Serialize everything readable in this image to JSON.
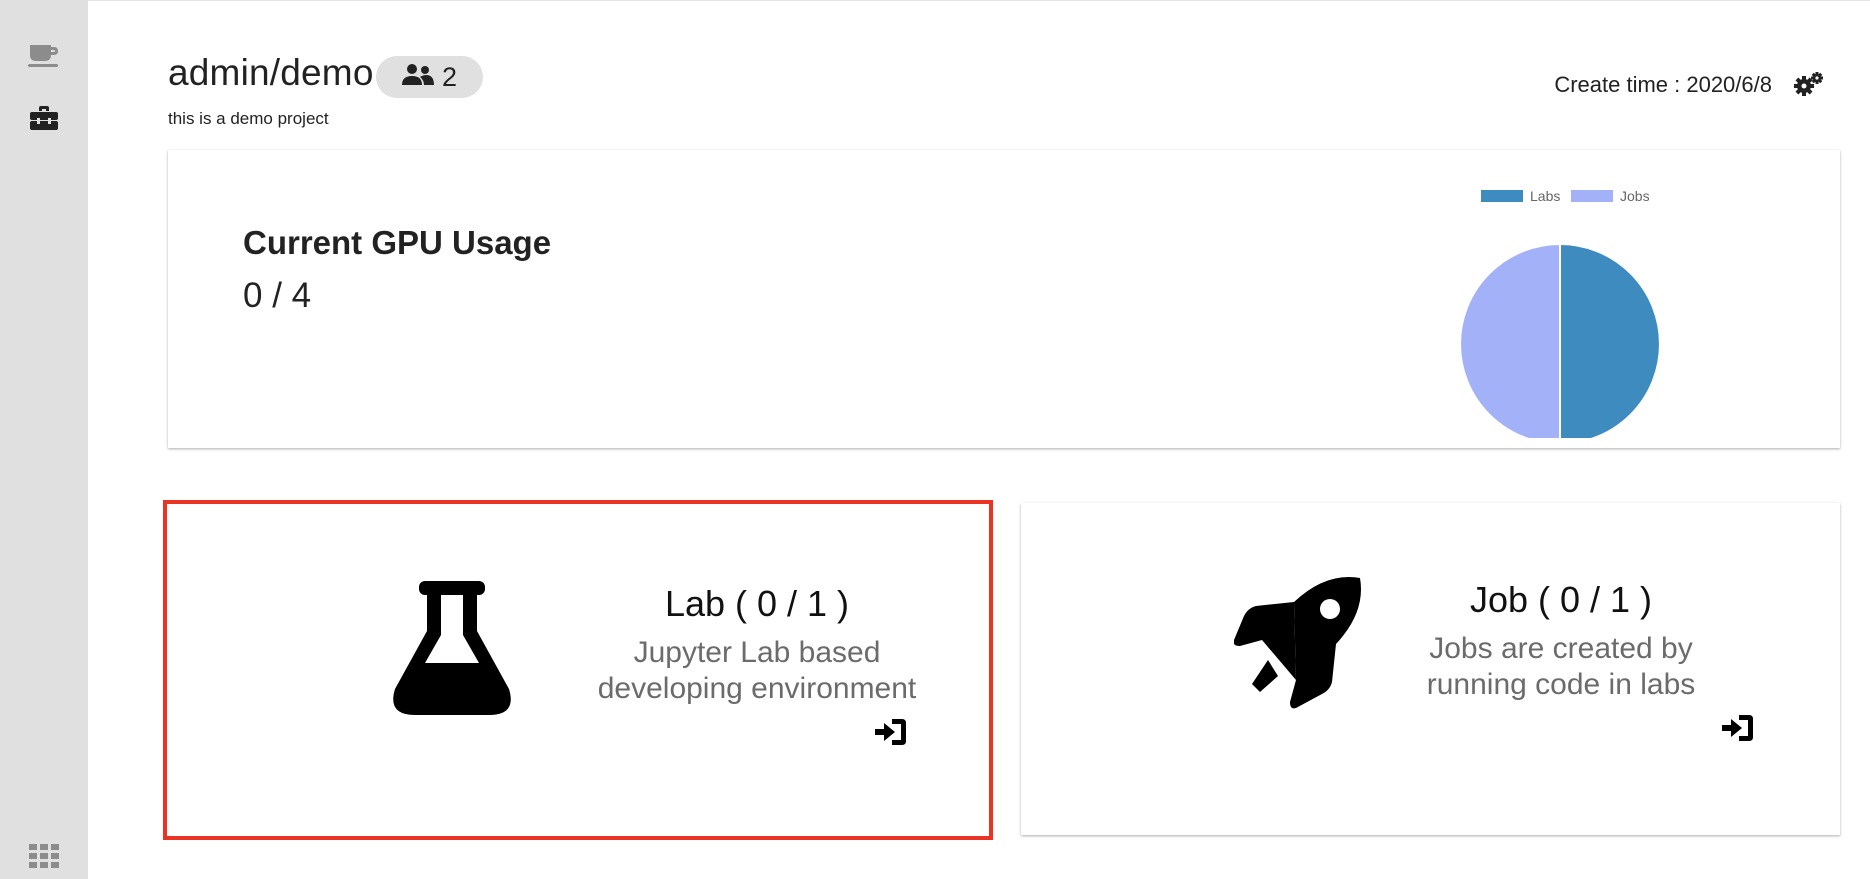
{
  "sidebar": {
    "items": [
      {
        "icon": "coffee-icon"
      },
      {
        "icon": "toolbox-icon"
      }
    ],
    "bottom": {
      "icon": "grid-menu-icon"
    }
  },
  "project": {
    "title": "admin/demo",
    "members_count": "2",
    "description": "this is a demo project",
    "create_time": "Create time : 2020/6/8"
  },
  "gpu": {
    "title": "Current GPU Usage",
    "value": "0 / 4"
  },
  "chart_data": {
    "type": "pie",
    "categories": [
      "Labs",
      "Jobs"
    ],
    "values": [
      1,
      1
    ],
    "colors": [
      "#3e8bbf",
      "#a3b2f8"
    ],
    "legend": "top"
  },
  "lab": {
    "title": "Lab ( 0 / 1 )",
    "desc_line1": "Jupyter Lab based",
    "desc_line2": "developing environment",
    "icon": "flask-icon"
  },
  "job": {
    "title": "Job ( 0 / 1 )",
    "desc_line1": "Jobs are created by",
    "desc_line2": "running code in labs",
    "icon": "rocket-icon"
  },
  "colors": {
    "sidebar_bg": "#e0e0e0",
    "highlight_border": "#ea3323",
    "labs": "#3e8bbf",
    "jobs": "#a3b2f8"
  }
}
